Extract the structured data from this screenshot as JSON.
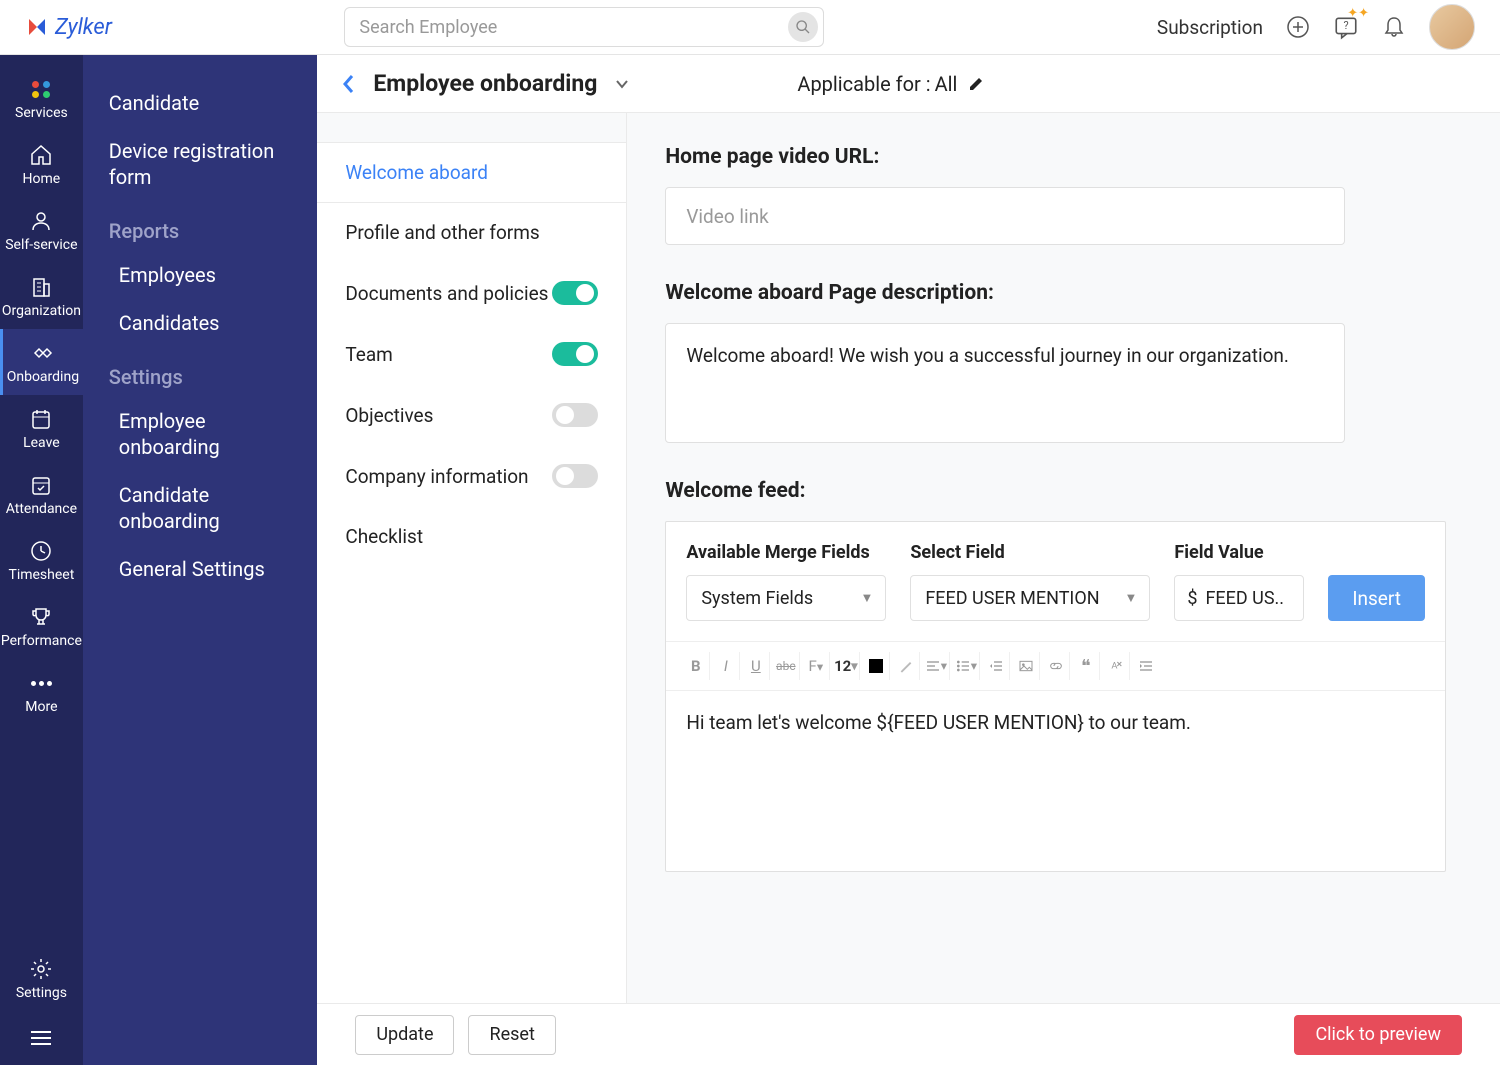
{
  "brand": {
    "name": "Zylker"
  },
  "topbar": {
    "search_placeholder": "Search Employee",
    "subscription": "Subscription"
  },
  "rail": [
    {
      "id": "services",
      "label": "Services"
    },
    {
      "id": "home",
      "label": "Home"
    },
    {
      "id": "selfservice",
      "label": "Self-service"
    },
    {
      "id": "organization",
      "label": "Organization"
    },
    {
      "id": "onboarding",
      "label": "Onboarding"
    },
    {
      "id": "leave",
      "label": "Leave"
    },
    {
      "id": "attendance",
      "label": "Attendance"
    },
    {
      "id": "timesheet",
      "label": "Timesheet"
    },
    {
      "id": "performance",
      "label": "Performance"
    },
    {
      "id": "more",
      "label": "More"
    },
    {
      "id": "settings",
      "label": "Settings"
    }
  ],
  "sidebar": {
    "items_top": [
      "Candidate",
      "Device registration form"
    ],
    "reports_heading": "Reports",
    "reports_items": [
      "Employees",
      "Candidates"
    ],
    "settings_heading": "Settings",
    "settings_items": [
      "Employee onboarding",
      "Candidate onboarding",
      "General Settings"
    ]
  },
  "page": {
    "title": "Employee onboarding",
    "applicable_prefix": "Applicable for :",
    "applicable_value": "All"
  },
  "steps": [
    {
      "label": "Welcome aboard",
      "active": true,
      "toggle": null
    },
    {
      "label": "Profile and other forms",
      "toggle": null
    },
    {
      "label": "Documents and policies",
      "toggle": true
    },
    {
      "label": "Team",
      "toggle": true
    },
    {
      "label": "Objectives",
      "toggle": false
    },
    {
      "label": "Company information",
      "toggle": false
    },
    {
      "label": "Checklist",
      "toggle": null
    }
  ],
  "form": {
    "video_label": "Home page video URL:",
    "video_placeholder": "Video link",
    "desc_label": "Welcome aboard Page description:",
    "desc_value": "Welcome aboard! We wish you a successful journey in our organization.",
    "feed_label": "Welcome feed:",
    "merge": {
      "col1_label": "Available Merge Fields",
      "col1_value": "System Fields",
      "col2_label": "Select Field",
      "col2_value": "FEED USER MENTION",
      "col3_label": "Field Value",
      "col3_value": "FEED US..",
      "insert": "Insert"
    },
    "rte": {
      "fontsize": "12",
      "content": "Hi team let's welcome ${FEED USER MENTION} to our team."
    }
  },
  "footer": {
    "update": "Update",
    "reset": "Reset",
    "preview": "Click to preview"
  }
}
